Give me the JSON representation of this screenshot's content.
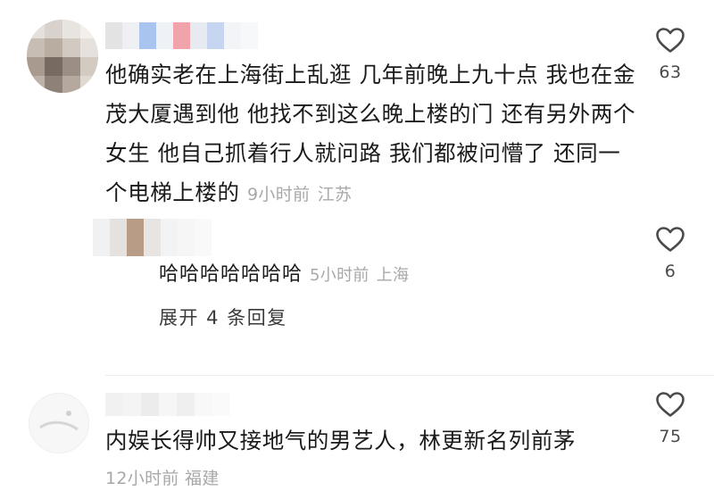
{
  "comments": [
    {
      "text": "他确实老在上海街上乱逛 几年前晚上九十点 我也在金茂大厦遇到他 他找不到这么晚上楼的门 还有另外两个女生 他自己抓着行人就问路 我们都被问懵了 还同一个电梯上楼的",
      "time": "9小时前",
      "location": "江苏",
      "likes": "63"
    },
    {
      "text": "内娱长得帅又接地气的男艺人，林更新名列前茅",
      "time": "12小时前",
      "location": "福建",
      "likes": "75"
    }
  ],
  "reply": {
    "text": "哈哈哈哈哈哈哈",
    "time": "5小时前",
    "location": "上海",
    "likes": "6"
  },
  "expand_replies_label": "展开 4 条回复",
  "icons": {
    "like": "heart-outline-icon"
  },
  "colors": {
    "text": "#1a1a1a",
    "meta": "#a8a8a8",
    "icon": "#4a4a4a"
  }
}
